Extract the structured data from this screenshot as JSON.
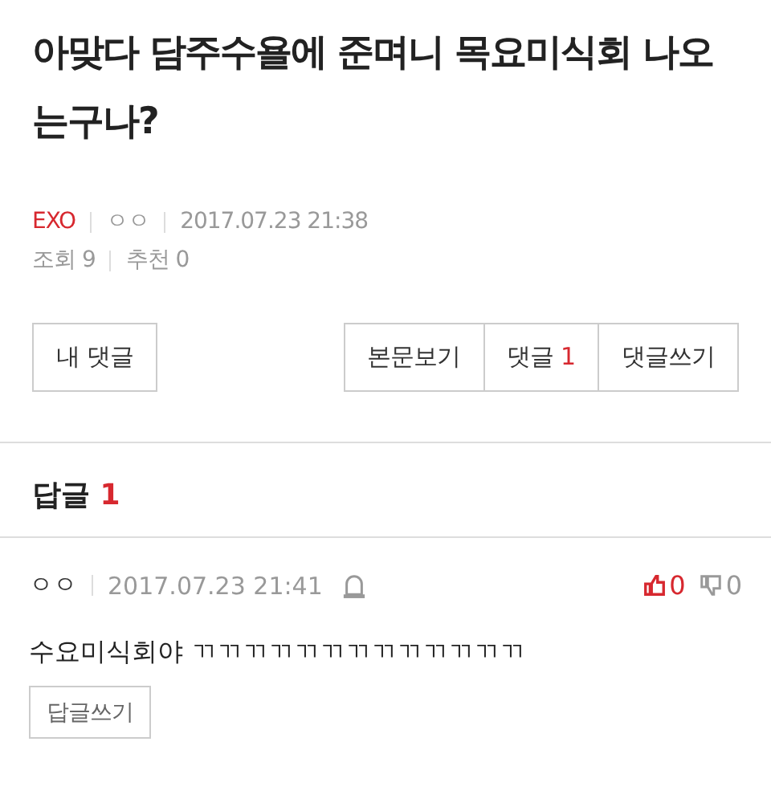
{
  "post": {
    "title": "아맞다 담주수욜에 준며니 목요미식회 나오는구나?",
    "category": "EXO",
    "author": "ㅇㅇ",
    "date": "2017.07.23 21:38",
    "views_label": "조회",
    "views": "9",
    "recommend_label": "추천",
    "recommend": "0"
  },
  "buttons_left": [
    "내 댓글"
  ],
  "buttons_right": [
    {
      "label": "본문보기"
    },
    {
      "label": "댓글",
      "count": "1"
    },
    {
      "label": "댓글쓰기"
    }
  ],
  "replies_header": {
    "label": "답글",
    "count": "1"
  },
  "comments": [
    {
      "author": "ㅇㅇ",
      "date": "2017.07.23 21:41",
      "likes": "0",
      "dislikes": "0",
      "text": "수요미식회야 ㄲㄲㄲㄲㄲㄲㄲㄲㄲㄲㄲㄲㄲ",
      "reply_button": "답글쓰기"
    }
  ]
}
